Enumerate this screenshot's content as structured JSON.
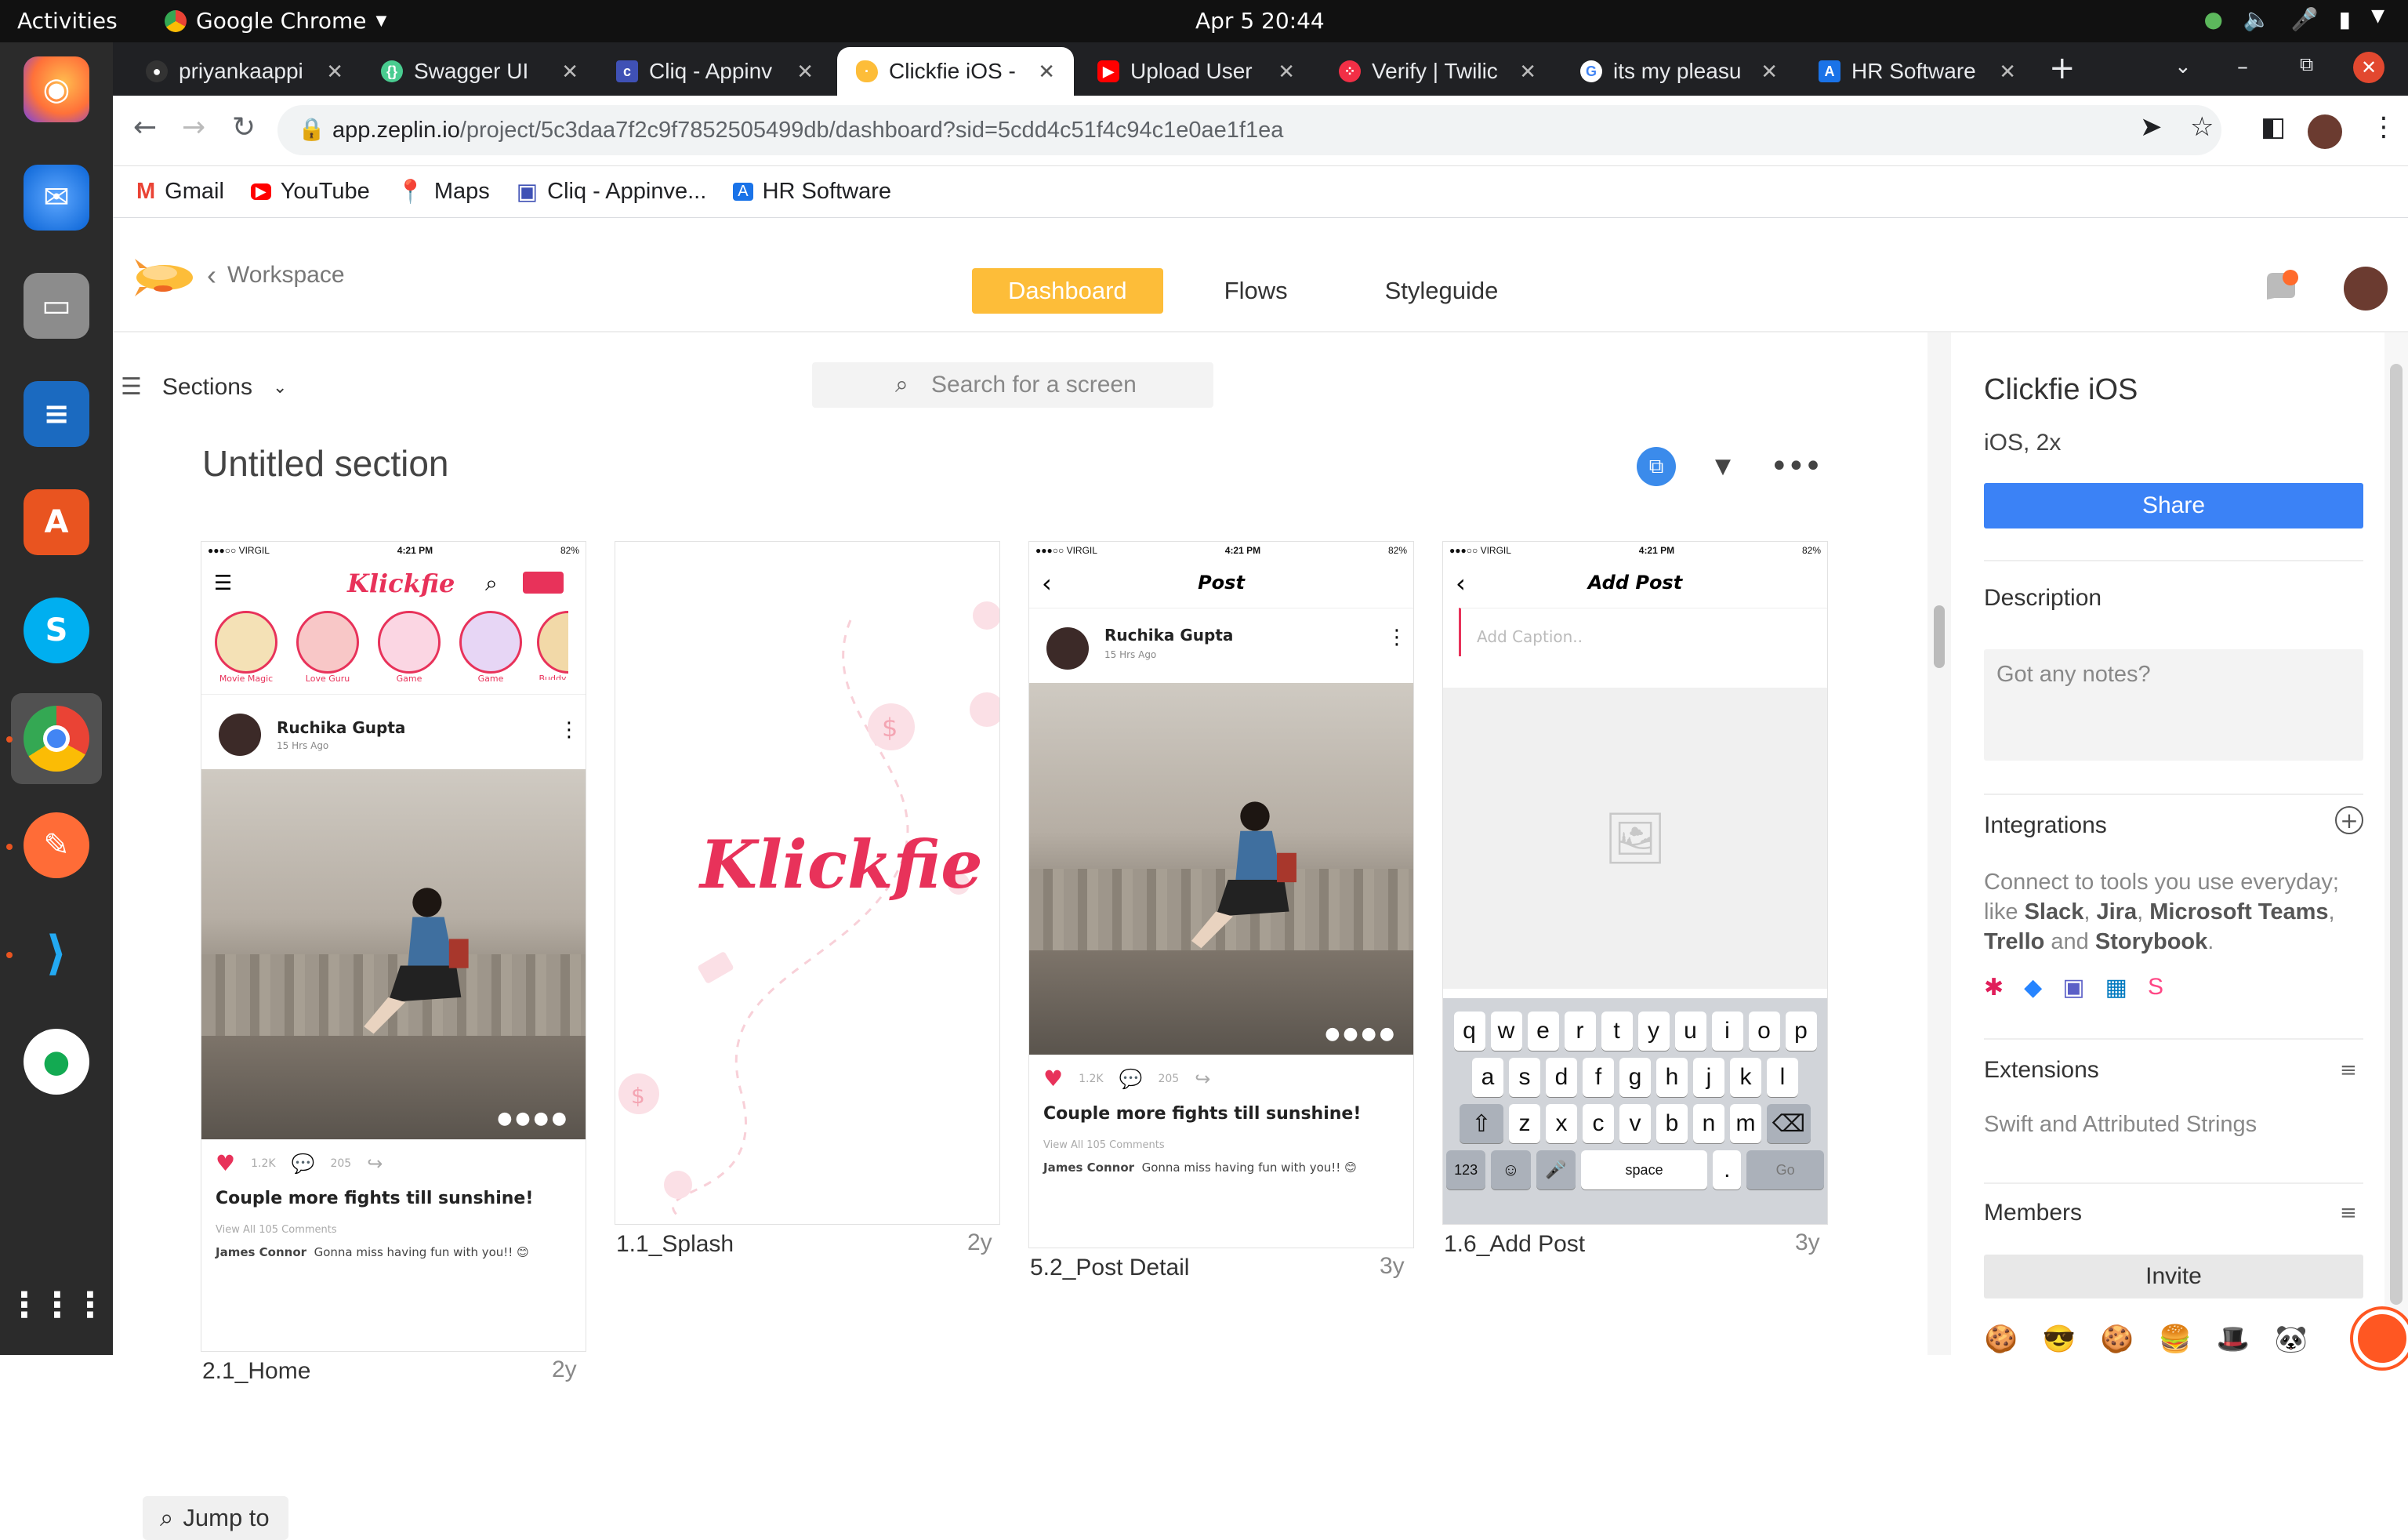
{
  "os": {
    "activities": "Activities",
    "app_name": "Google Chrome",
    "clock": "Apr 5  20:44"
  },
  "tabs": [
    {
      "label": "priyankaappi",
      "icon": "github-icon",
      "color": "#24292e"
    },
    {
      "label": "Swagger UI",
      "icon": "swagger-icon",
      "color": "#49cc90"
    },
    {
      "label": "Cliq - Appinv",
      "icon": "cliq-icon",
      "color": "#3f51b5"
    },
    {
      "label": "Clickfie iOS -",
      "icon": "zeplin-icon",
      "color": "#fdbd39"
    },
    {
      "label": "Upload User",
      "icon": "youtube-icon",
      "color": "#ff0000"
    },
    {
      "label": "Verify | Twilic",
      "icon": "twilio-icon",
      "color": "#f22f46"
    },
    {
      "label": "its my pleasu",
      "icon": "google-icon",
      "color": "#4285f4"
    },
    {
      "label": "HR Software",
      "icon": "hr-icon",
      "color": "#1a73e8"
    }
  ],
  "url": {
    "domain": "app.zeplin.io",
    "path": "/project/5c3daa7f2c9f7852505499db/dashboard?sid=5cdd4c51f4c94c1e0ae1f1ea"
  },
  "bookmarks": [
    {
      "label": "Gmail",
      "icon": "gmail-icon",
      "color": "#ea4335"
    },
    {
      "label": "YouTube",
      "icon": "youtube-icon",
      "color": "#ff0000"
    },
    {
      "label": "Maps",
      "icon": "maps-icon",
      "color": "#34a853"
    },
    {
      "label": "Cliq - Appinve...",
      "icon": "cliq-icon",
      "color": "#3f51b5"
    },
    {
      "label": "HR Software",
      "icon": "hr-icon",
      "color": "#1a73e8"
    }
  ],
  "zeplin": {
    "back_label": "Workspace",
    "nav": [
      "Dashboard",
      "Flows",
      "Styleguide"
    ],
    "sections_label": "Sections",
    "search_placeholder": "Search for a screen",
    "section_title": "Untitled section",
    "jump_to": "Jump to",
    "accent": "#fdbd39"
  },
  "screens": [
    {
      "name": "2.1_Home",
      "age": "2y",
      "status": {
        "carrier": "●●●○○ VIRGIL",
        "time": "4:21 PM",
        "battery": "82%"
      },
      "logo": "Klickfie",
      "stories": [
        "Movie Magic",
        "Love Guru",
        "Game",
        "Game",
        "Buddy"
      ],
      "post": {
        "author": "Ruchika Gupta",
        "time": "15 Hrs Ago",
        "likes": "1.2K",
        "comments": "205",
        "caption": "Couple more fights till sunshine!",
        "view_all": "View All 105 Comments",
        "commenter": "James Connor",
        "comment": "Gonna miss having fun with you!! 😊"
      }
    },
    {
      "name": "1.1_Splash",
      "age": "2y",
      "logo": "Klickfie"
    },
    {
      "name": "5.2_Post Detail",
      "age": "3y",
      "status": {
        "carrier": "●●●○○ VIRGIL",
        "time": "4:21 PM",
        "battery": "82%"
      },
      "title": "Post",
      "post": {
        "author": "Ruchika Gupta",
        "time": "15 Hrs Ago",
        "likes": "1.2K",
        "comments": "205",
        "caption": "Couple more fights till sunshine!",
        "view_all": "View All 105 Comments",
        "commenter": "James Connor",
        "comment": "Gonna miss having fun with you!! 😊"
      }
    },
    {
      "name": "1.6_Add Post",
      "age": "3y",
      "status": {
        "carrier": "●●●○○ VIRGIL",
        "time": "4:21 PM",
        "battery": "82%"
      },
      "title": "Add Post",
      "caption_placeholder": "Add Caption..",
      "keyboard": {
        "row1": [
          "q",
          "w",
          "e",
          "r",
          "t",
          "y",
          "u",
          "i",
          "o",
          "p"
        ],
        "row2": [
          "a",
          "s",
          "d",
          "f",
          "g",
          "h",
          "j",
          "k",
          "l"
        ],
        "row3": [
          "z",
          "x",
          "c",
          "v",
          "b",
          "n",
          "m"
        ],
        "num": "123",
        "space": "space",
        "dot": ".",
        "go": "Go"
      }
    }
  ],
  "panel": {
    "project": "Clickfie iOS",
    "platform": "iOS, 2x",
    "share": "Share",
    "description_h": "Description",
    "notes_placeholder": "Got any notes?",
    "integrations_h": "Integrations",
    "integrations_text_1": "Connect to tools you use everyday; like ",
    "slack": "Slack",
    "sep1": ", ",
    "jira": "Jira",
    "sep2": ", ",
    "teams": "Microsoft Teams",
    "sep3": ", ",
    "trello": "Trello",
    "and": " and ",
    "storybook": "Storybook",
    "end": ".",
    "extensions_h": "Extensions",
    "extensions_text": "Swift and Attributed Strings",
    "members_h": "Members",
    "invite": "Invite",
    "members": [
      "🍪",
      "😎",
      "🍪",
      "🍔",
      "🎩",
      "🐼"
    ]
  }
}
